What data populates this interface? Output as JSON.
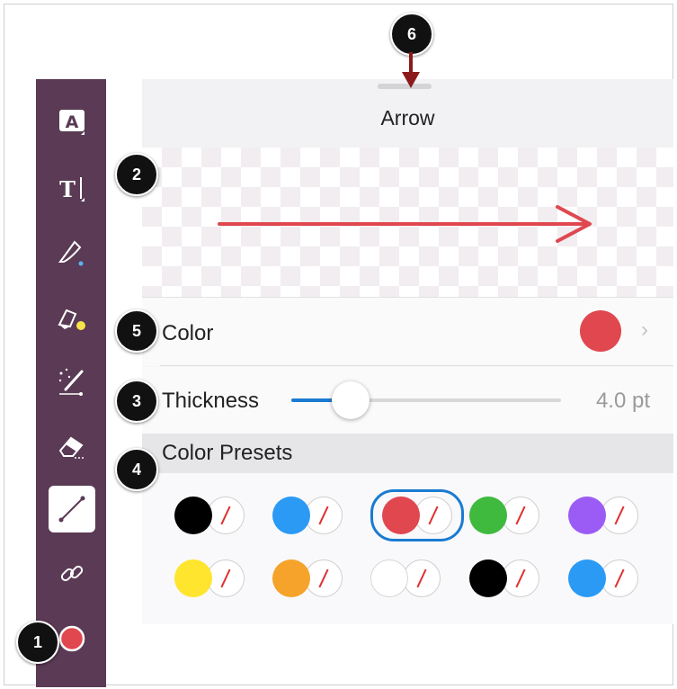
{
  "panel": {
    "title": "Arrow",
    "color_row": {
      "label": "Color",
      "value_color": "#e0474f",
      "chevron": "chevron-right-icon"
    },
    "thickness_row": {
      "label": "Thickness",
      "value": "4.0 pt",
      "fraction": 0.22
    },
    "presets": {
      "heading": "Color Presets",
      "items": [
        {
          "color": "#000000"
        },
        {
          "color": "#2a9af5"
        },
        {
          "color": "#e0474f",
          "selected": true
        },
        {
          "color": "#3fba3f"
        },
        {
          "color": "#9b5cf5"
        },
        {
          "color": "#ffe52e"
        },
        {
          "color": "#f5a32a"
        },
        {
          "color": "#ffffff"
        },
        {
          "color": "#000000"
        },
        {
          "color": "#2a9af5"
        }
      ]
    }
  },
  "toolbar": {
    "tools": [
      "text-box-icon",
      "text-cursor-icon",
      "pen-icon",
      "highlighter-icon",
      "magic-pen-icon",
      "eraser-icon",
      "arrow-line-icon",
      "link-icon",
      "color-dot-icon"
    ],
    "selected": "arrow-line-icon",
    "current_color": "#e0474f"
  },
  "callouts": [
    "1",
    "2",
    "3",
    "4",
    "5",
    "6"
  ],
  "colors": {
    "accent": "#1a7bd1",
    "arrow_red": "#e0474f",
    "toolbar": "#5a3a54"
  }
}
